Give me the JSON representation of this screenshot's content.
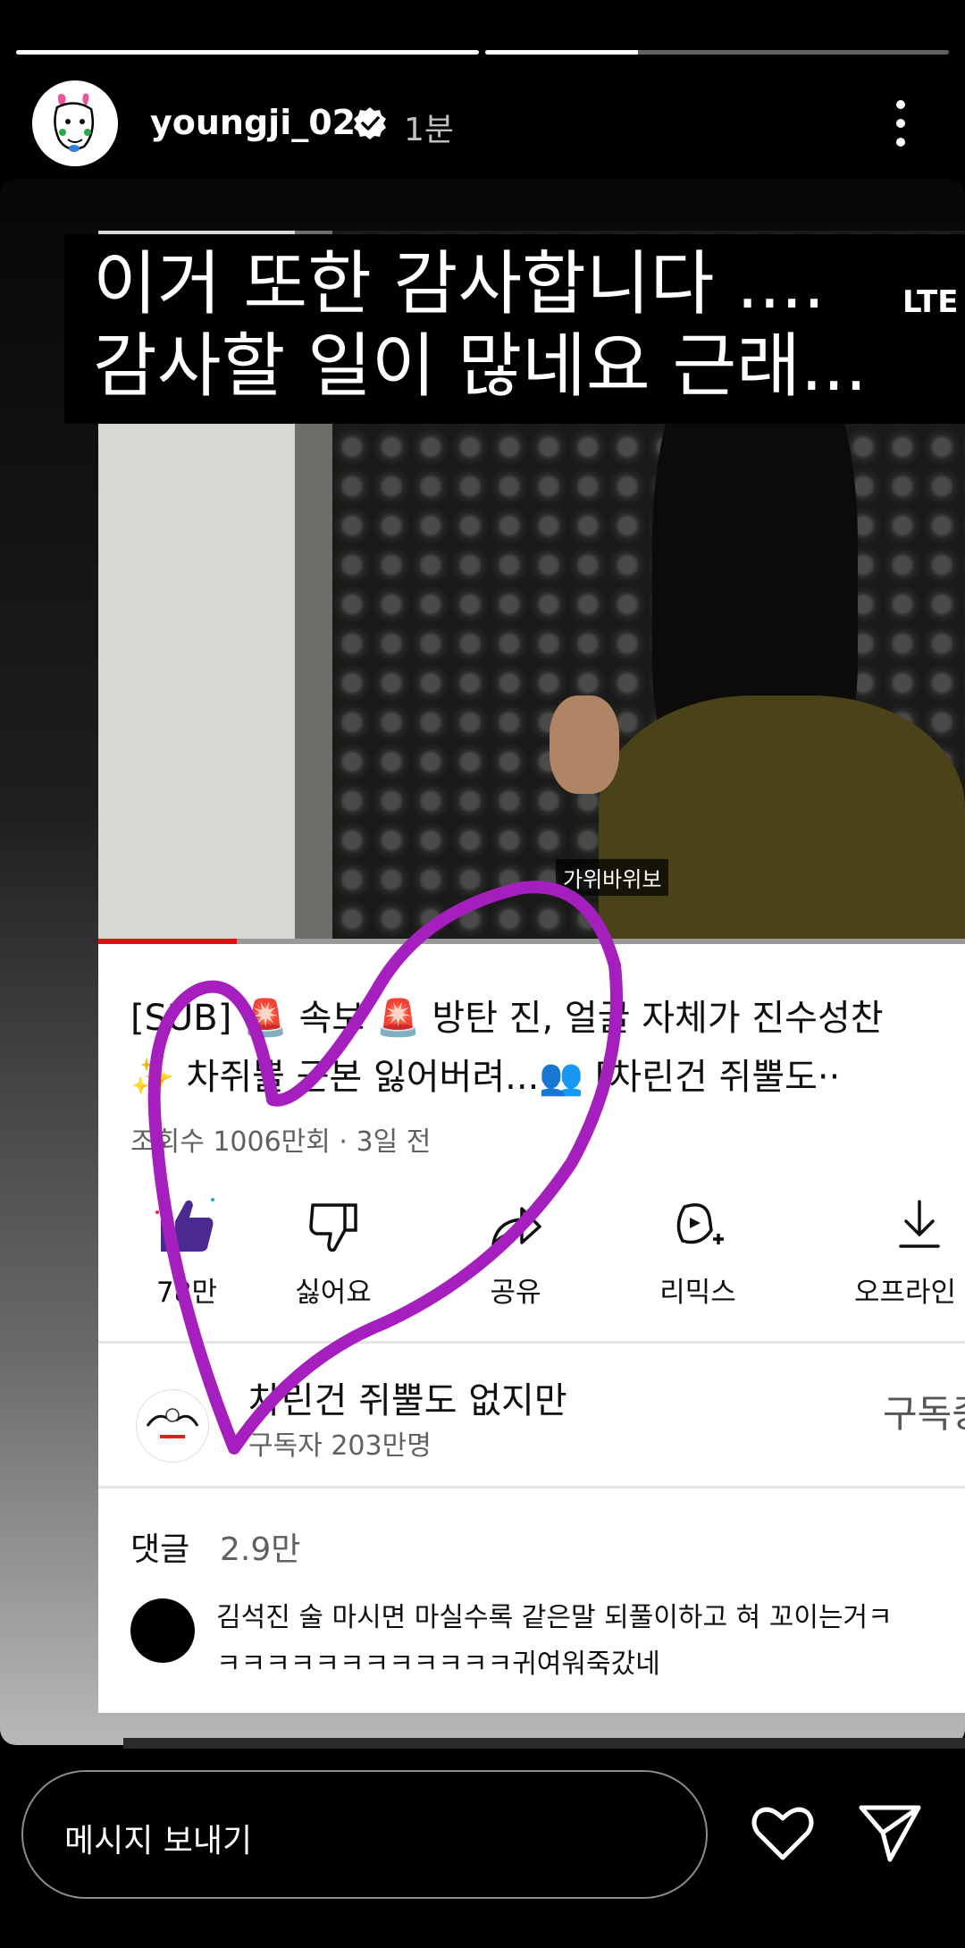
{
  "story": {
    "segments": [
      {
        "progress": 1.0
      },
      {
        "progress": 0.33
      }
    ],
    "username": "youngji_02",
    "time_ago": "1분",
    "icons": {
      "verified": "verified-badge-icon",
      "more": "more-vertical-icon"
    }
  },
  "overlay": {
    "line1": "이거 또한 감사합니다 ....",
    "line2": "감사할 일이 많네요 근래..."
  },
  "video": {
    "caption": "가위바위보",
    "status_text": "LTE",
    "progress": 0.16
  },
  "youtube": {
    "title_line1": "[SUB] 🚨 속보 🚨  방탄 진, 얼굴 자체가 진수성찬",
    "title_line2": "✨ 차쥐뿔 근본 잃어버려...👥    [차린건 쥐뿔도··",
    "meta": "조회수 1006만회 · 3일 전",
    "actions": {
      "like": "78만",
      "dislike": "싫어요",
      "share": "공유",
      "remix": "리믹스",
      "offline": "오프라인"
    },
    "channel": {
      "name": "차린건 쥐뿔도 없지만",
      "subscribers": "구독자 203만명",
      "subscribe_label": "구독중"
    },
    "comments": {
      "label": "댓글",
      "count": "2.9만",
      "line1": "김석진 술 마시면 마실수록 같은말 되풀이하고 혀 꼬이는거ㅋ",
      "line2": "ㅋㅋㅋㅋㅋㅋㅋㅋㅋㅋㅋㅋ귀여워죽갔네"
    }
  },
  "reply": {
    "placeholder": "메시지 보내기",
    "icons": {
      "like": "heart-outline-icon",
      "send": "send-icon"
    }
  },
  "colors": {
    "doodle": "#a51fbf",
    "like_purple": "#4b2a8f",
    "yt_red": "#e01010"
  }
}
